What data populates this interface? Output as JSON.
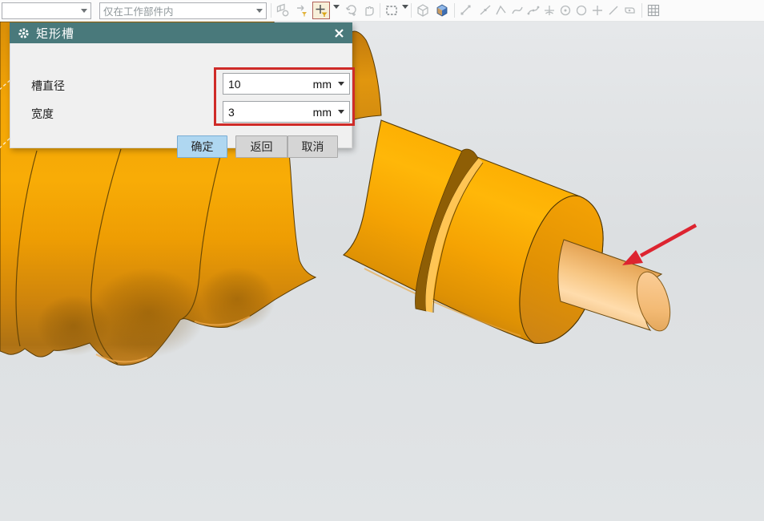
{
  "toolbar": {
    "combo1_value": "",
    "combo2_value": "仅在工作部件内",
    "icon_names": [
      "assembly-constraints-icon",
      "move-component-icon",
      "snap-point-icon",
      "rotate-reposition-icon",
      "hand-reposition-icon",
      "marquee-select-icon",
      "shaded-wireframe-cube-icon",
      "shaded-view-cube-icon",
      "snap-endpoint-icon",
      "snap-midpoint-icon",
      "snap-control-point-icon",
      "snap-intersection-icon",
      "snap-spline-point-icon",
      "snap-arc-center-icon",
      "snap-circle-center-icon",
      "snap-circle-icon",
      "snap-point-plus-icon",
      "snap-line-icon",
      "snap-face-icon",
      "grid-snap-icon"
    ]
  },
  "dialog": {
    "title": "矩形槽",
    "rows": [
      {
        "label": "槽直径",
        "value": "10",
        "unit": "mm"
      },
      {
        "label": "宽度",
        "value": "3",
        "unit": "mm"
      }
    ],
    "buttons": {
      "ok": "确定",
      "back": "返回",
      "cancel": "取消"
    }
  },
  "viewport": {
    "model": "stepped worm shaft with rectangular groove and end stub",
    "body_color": "#F5A303",
    "groove_color": "#8E5E05",
    "background_color": "#DFE2E4",
    "annotation_arrow_color": "#DD2430",
    "highlight_box_color": "#CF2B28"
  }
}
